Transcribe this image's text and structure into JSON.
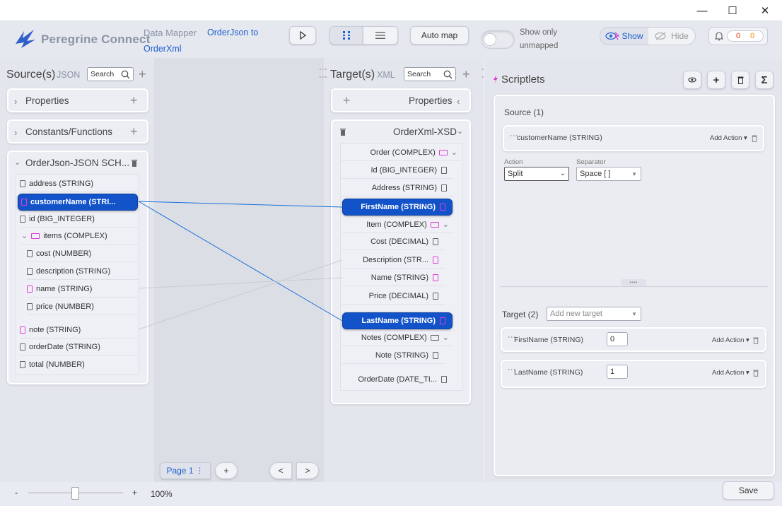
{
  "app": {
    "name": "Peregrine Connect",
    "section": "Data Mapper",
    "map_name_line1": "OrderJson to",
    "map_name_line2": "OrderXml"
  },
  "window_controls": {
    "minimize": "—",
    "maximize": "☐",
    "close": "✕"
  },
  "toolbar": {
    "auto_map_label": "Auto map",
    "show_only_line1": "Show only",
    "show_only_line2": "unmapped",
    "show_label": "Show",
    "hide_label": "Hide",
    "errors_count": "0",
    "warnings_count": "0"
  },
  "colors": {
    "accent": "#1253c9",
    "pink": "#e23bd6",
    "link": "#1a5fd0"
  },
  "source": {
    "title": "Source(s)",
    "format": "JSON",
    "search_placeholder": "Search",
    "properties_label": "Properties",
    "constants_label": "Constants/Functions",
    "schema_label": "OrderJson-JSON SCH...",
    "items": {
      "address": "address (STRING)",
      "customerName": "customerName (STRI...",
      "id": "id (BIG_INTEGER)",
      "items": "items (COMPLEX)",
      "cost": "cost (NUMBER)",
      "description": "description (STRING)",
      "name": "name (STRING)",
      "price": "price (NUMBER)",
      "note": "note (STRING)",
      "orderDate": "orderDate (STRING)",
      "total": "total (NUMBER)"
    }
  },
  "target": {
    "title": "Target(s)",
    "format": "XML",
    "search_placeholder": "Search",
    "properties_label": "Properties",
    "schema_label": "OrderXml-XSD",
    "items": {
      "order": "Order (COMPLEX)",
      "id": "Id (BIG_INTEGER)",
      "address": "Address (STRING)",
      "firstName": "FirstName (STRING)",
      "item": "Item (COMPLEX)",
      "cost": "Cost (DECIMAL)",
      "description": "Description (STR...",
      "name": "Name (STRING)",
      "price": "Price (DECIMAL)",
      "lastName": "LastName (STRING)",
      "notes": "Notes (COMPLEX)",
      "note": "Note (STRING)",
      "orderDate": "OrderDate (DATE_TI..."
    }
  },
  "pager": {
    "page_label": "Page 1",
    "add": "+",
    "prev": "<",
    "next": ">"
  },
  "scriptlets": {
    "title": "Scriptlets",
    "source_header": "Source (1)",
    "source_field": "customerName (STRING)",
    "add_action": "Add Action",
    "action_label": "Action",
    "action_value": "Split",
    "separator_label": "Separator",
    "separator_value": "Space [ ]",
    "target_header": "Target (2)",
    "add_target_placeholder": "Add new target",
    "targets": [
      {
        "name": "FirstName (STRING)",
        "index": "0"
      },
      {
        "name": "LastName (STRING)",
        "index": "1"
      }
    ]
  },
  "zoom": {
    "minus": "-",
    "plus": "+",
    "value": "100%"
  },
  "footer": {
    "save_label": "Save"
  }
}
